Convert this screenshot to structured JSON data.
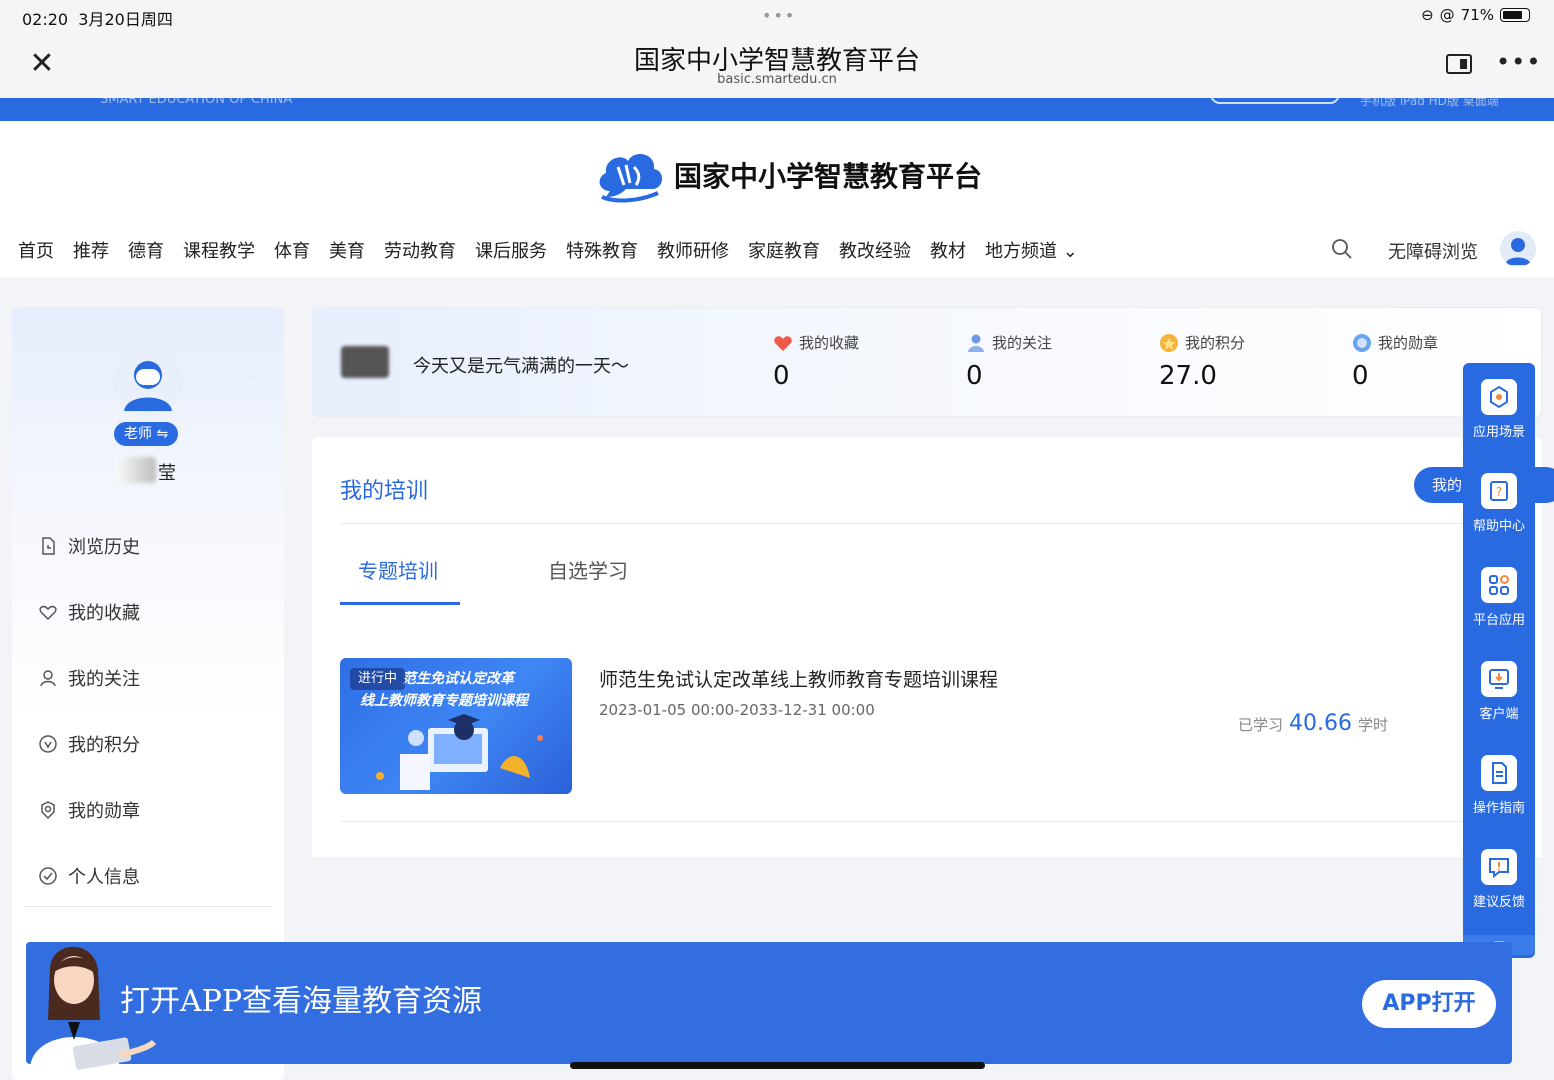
{
  "status_bar": {
    "time": "02:20",
    "date": "3月20日周四",
    "dots": "•••",
    "battery": "71%"
  },
  "browser": {
    "title": "国家中小学智慧教育平台",
    "url": "basic.smartedu.cn",
    "more": "•••"
  },
  "band": {
    "left_text": "SMART EDUCATION OF CHINA",
    "right_text": "手机版 iPad HD版 桌面端"
  },
  "header": {
    "logo_text": "国家中小学智慧教育平台",
    "nav": [
      "首页",
      "推荐",
      "德育",
      "课程教学",
      "体育",
      "美育",
      "劳动教育",
      "课后服务",
      "特殊教育",
      "教师研修",
      "家庭教育",
      "教改经验",
      "教材",
      "地方频道"
    ],
    "nav_dropdown_caret": "⌄",
    "accessibility": "无障碍浏览"
  },
  "sidebar": {
    "role": "老师 ⇋",
    "name": "莹",
    "menu": [
      {
        "label": "浏览历史",
        "icon": "history-icon"
      },
      {
        "label": "我的收藏",
        "icon": "heart-icon"
      },
      {
        "label": "我的关注",
        "icon": "user-icon"
      },
      {
        "label": "我的积分",
        "icon": "points-icon"
      },
      {
        "label": "我的勋章",
        "icon": "medal-icon"
      },
      {
        "label": "个人信息",
        "icon": "check-icon"
      }
    ]
  },
  "stats": {
    "greeting": "今天又是元气满满的一天～",
    "items": [
      {
        "label": "我的收藏",
        "value": "0",
        "icon": "heart-icon",
        "color": "#ef5a4a"
      },
      {
        "label": "我的关注",
        "value": "0",
        "icon": "user-icon",
        "color": "#6f9ae8"
      },
      {
        "label": "我的积分",
        "value": "27.0",
        "icon": "coin-icon",
        "color": "#f6b334"
      },
      {
        "label": "我的勋章",
        "value": "0",
        "icon": "medal-icon",
        "color": "#6aa3f0"
      }
    ]
  },
  "training": {
    "title": "我的培训",
    "my_button": "我的",
    "tabs": [
      "专题培训",
      "自选学习"
    ],
    "course": {
      "badge": "进行中",
      "thumb_line1": "范生免试认定改革",
      "thumb_line2": "线上教师教育专题培训课程",
      "name": "师范生免试认定改革线上教师教育专题培训课程",
      "date_range": "2023-01-05 00:00-2033-12-31 00:00",
      "progress_prefix": "已学习",
      "progress_value": "40.66",
      "progress_unit": "学时"
    }
  },
  "right_toolbar": [
    {
      "label": "应用场景",
      "icon": "scene-icon"
    },
    {
      "label": "帮助中心",
      "icon": "help-icon"
    },
    {
      "label": "平台应用",
      "icon": "apps-icon"
    },
    {
      "label": "客户端",
      "icon": "client-icon"
    },
    {
      "label": "操作指南",
      "icon": "guide-icon"
    },
    {
      "label": "建议反馈",
      "icon": "feedback-icon"
    }
  ],
  "app_banner": {
    "text": "打开APP查看海量教育资源",
    "button": "APP打开"
  },
  "colors": {
    "brand_blue": "#2a6ae0"
  }
}
